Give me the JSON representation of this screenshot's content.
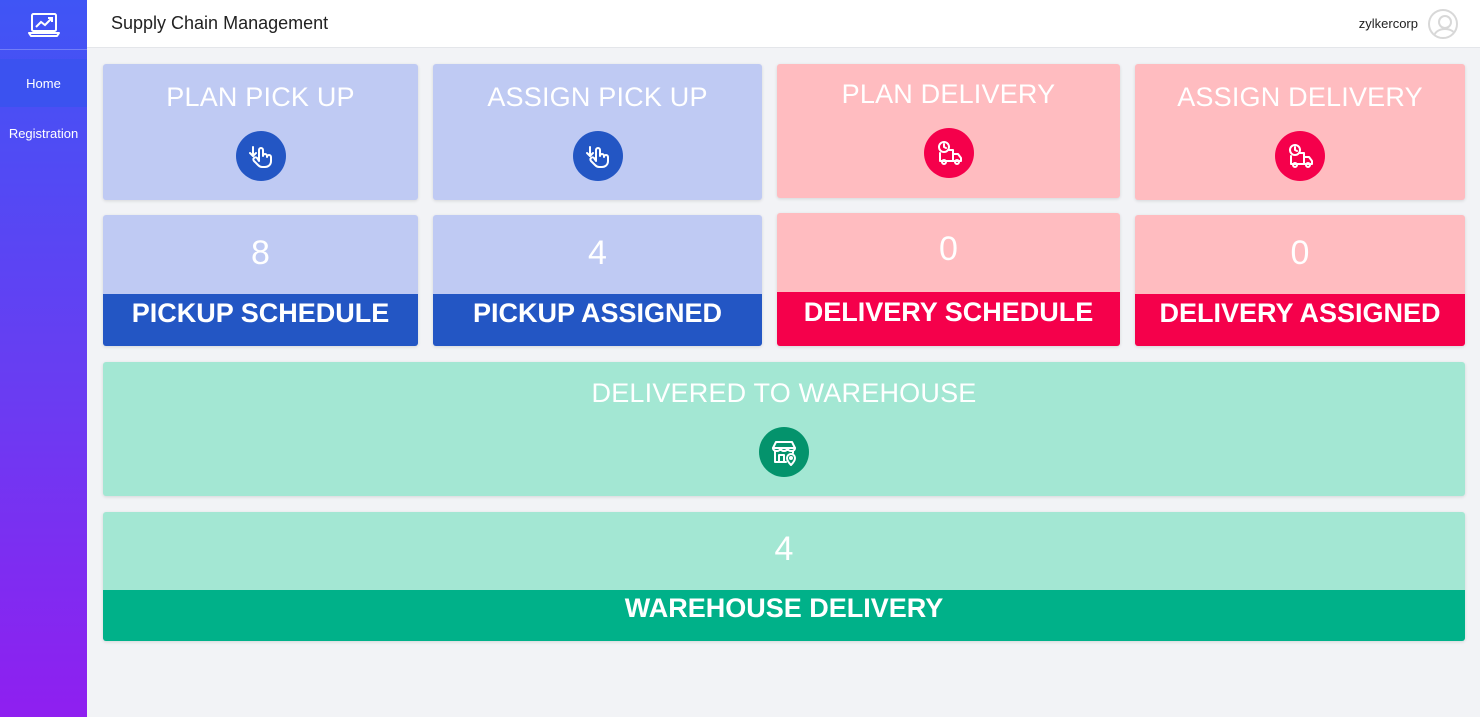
{
  "app": {
    "title": "Supply Chain Management",
    "user": "zylkercorp"
  },
  "sidebar": {
    "items": [
      {
        "label": "Home"
      },
      {
        "label": "Registration"
      }
    ]
  },
  "actions": {
    "plan_pickup": {
      "label": "PLAN PICK UP",
      "icon": "hand-pointer-icon"
    },
    "assign_pickup": {
      "label": "ASSIGN PICK UP",
      "icon": "hand-pointer-icon"
    },
    "plan_delivery": {
      "label": "PLAN DELIVERY",
      "icon": "delivery-truck-icon"
    },
    "assign_delivery": {
      "label": "ASSIGN DELIVERY",
      "icon": "delivery-truck-icon"
    },
    "delivered_warehouse": {
      "label": "DELIVERED TO WAREHOUSE",
      "icon": "warehouse-store-icon"
    }
  },
  "stats": {
    "pickup_schedule": {
      "value": "8",
      "label": "PICKUP SCHEDULE"
    },
    "pickup_assigned": {
      "value": "4",
      "label": "PICKUP ASSIGNED"
    },
    "delivery_schedule": {
      "value": "0",
      "label": "DELIVERY SCHEDULE"
    },
    "delivery_assigned": {
      "value": "0",
      "label": "DELIVERY ASSIGNED"
    },
    "warehouse_delivery": {
      "value": "4",
      "label": "WAREHOUSE DELIVERY"
    }
  },
  "colors": {
    "blue_light": "#bfcaf3",
    "blue_dark": "#2356c4",
    "red_light": "#ffbcc0",
    "red_dark": "#f5004b",
    "green_light": "#a3e7d3",
    "green_dark": "#00b189"
  }
}
